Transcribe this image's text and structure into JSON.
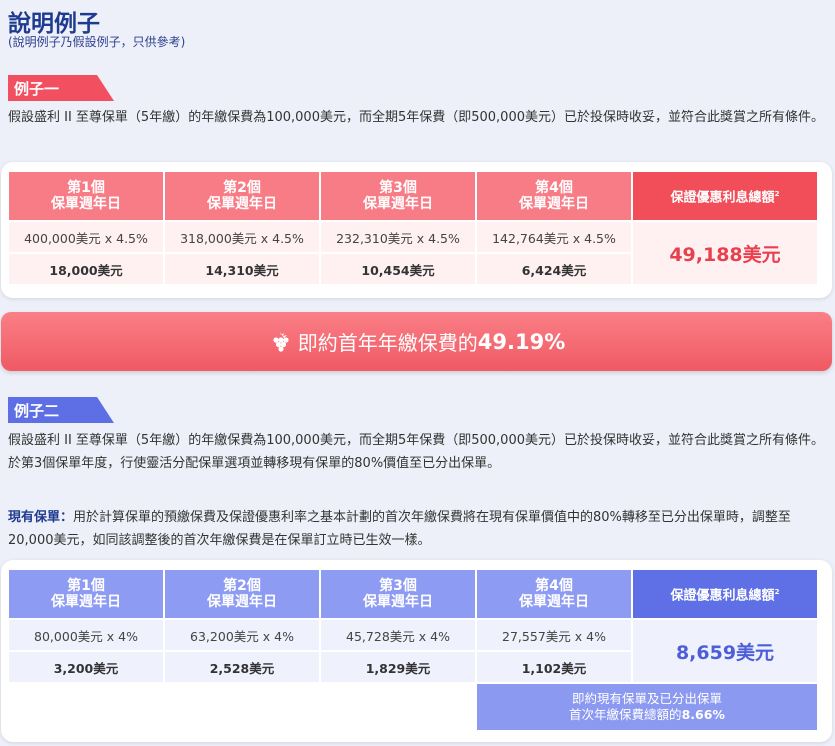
{
  "header": {
    "title": "說明例子",
    "subtitle": "(說明例子乃假設例子，只供參考)"
  },
  "example1": {
    "tag": "例子一",
    "description": "假設盛利 II 至尊保單（5年繳）的年繳保費為100,000美元，而全期5年保費（即500,000美元）已於投保時收妥，並符合此獎賞之所有條件。",
    "columns": [
      {
        "line1": "第1個",
        "line2": "保單週年日",
        "formula": "400,000美元 x 4.5%",
        "amount": "18,000美元"
      },
      {
        "line1": "第2個",
        "line2": "保單週年日",
        "formula": "318,000美元 x 4.5%",
        "amount": "14,310美元"
      },
      {
        "line1": "第3個",
        "line2": "保單週年日",
        "formula": "232,310美元 x 4.5%",
        "amount": "10,454美元"
      },
      {
        "line1": "第4個",
        "line2": "保單週年日",
        "formula": "142,764美元 x 4.5%",
        "amount": "6,424美元"
      }
    ],
    "total_header": "保證優惠利息總額",
    "total_sup": "2",
    "total": "49,188美元",
    "banner_text": "即約首年年繳保費的",
    "banner_pct": "49.19%"
  },
  "example2": {
    "tag": "例子二",
    "description": "假設盛利 II 至尊保單（5年繳）的年繳保費為100,000美元，而全期5年保費（即500,000美元）已於投保時收妥，並符合此獎賞之所有條件。於第3個保單年度，行使靈活分配保單選項並轉移現有保單的80%價值至已分出保單。",
    "existing_label": "現有保單：",
    "existing_text": "用於計算保單的預繳保費及保證優惠利率之基本計劃的首次年繳保費將在現有保單價值中的80%轉移至已分出保單時，調整至20,000美元，如同該調整後的首次年繳保費是在保單訂立時已生效一樣。",
    "columns": [
      {
        "line1": "第1個",
        "line2": "保單週年日",
        "formula": "80,000美元 x 4%",
        "amount": "3,200美元"
      },
      {
        "line1": "第2個",
        "line2": "保單週年日",
        "formula": "63,200美元 x 4%",
        "amount": "2,528美元"
      },
      {
        "line1": "第3個",
        "line2": "保單週年日",
        "formula": "45,728美元 x 4%",
        "amount": "1,829美元"
      },
      {
        "line1": "第4個",
        "line2": "保單週年日",
        "formula": "27,557美元 x 4%",
        "amount": "1,102美元"
      }
    ],
    "total_header": "保證優惠利息總額",
    "total_sup": "2",
    "total": "8,659美元",
    "note_line1": "即約現有保單及已分出保單",
    "note_line2": "首次年繳保費總額的",
    "note_pct": "8.66%"
  },
  "icons": {
    "banner_icon": "grape-icon"
  },
  "colors": {
    "red_accent": "#f24e5a",
    "blue_accent": "#5f6fe6",
    "title_navy": "#1f3b8f"
  }
}
